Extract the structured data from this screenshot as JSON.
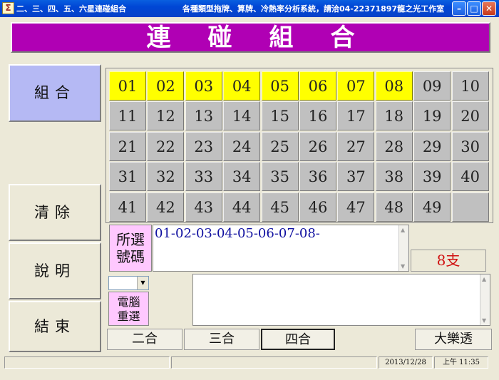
{
  "window": {
    "title_left": "二、三、四、五、六星連碰組合",
    "title_right": "各種類型拖牌、算牌、冷熱率分析系統，請洽04-22371897龍之光工作室",
    "app_icon": "Σ",
    "minimize": "–",
    "maximize": "□",
    "close": "✕"
  },
  "banner": {
    "title": "連碰組合"
  },
  "sidebar": {
    "combine": "組合",
    "clear": "清除",
    "help": "說明",
    "exit": "結束"
  },
  "grid": {
    "numbers": [
      "01",
      "02",
      "03",
      "04",
      "05",
      "06",
      "07",
      "08",
      "09",
      "10",
      "11",
      "12",
      "13",
      "14",
      "15",
      "16",
      "17",
      "18",
      "19",
      "20",
      "21",
      "22",
      "23",
      "24",
      "25",
      "26",
      "27",
      "28",
      "29",
      "30",
      "31",
      "32",
      "33",
      "34",
      "35",
      "36",
      "37",
      "38",
      "39",
      "40",
      "41",
      "42",
      "43",
      "44",
      "45",
      "46",
      "47",
      "48",
      "49"
    ],
    "selected": [
      "01",
      "02",
      "03",
      "04",
      "05",
      "06",
      "07",
      "08"
    ]
  },
  "selection": {
    "label_line1": "所選",
    "label_line2": "號碼",
    "value": "01-02-03-04-05-06-07-08-",
    "count": "8支"
  },
  "random": {
    "label_line1": "電腦",
    "label_line2": "重選",
    "dropdown_value": ""
  },
  "tabs": {
    "two": "二合",
    "three": "三合",
    "four": "四合",
    "lotto": "大樂透",
    "active": "four"
  },
  "status": {
    "date": "2013/12/28",
    "time": "上午 11:35"
  },
  "colors": {
    "banner": "#B000B4",
    "selected_cell": "#FFFF00",
    "cell": "#C0C0C0",
    "pink_label": "#FFC8FF",
    "count_text": "#D01010",
    "selection_text": "#1010A0",
    "active_sidebar": "#B5B9F4"
  }
}
